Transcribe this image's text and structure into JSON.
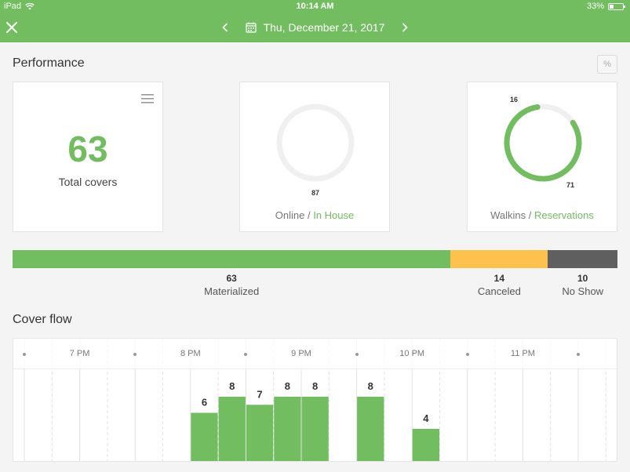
{
  "status_bar": {
    "device": "iPad",
    "time": "10:14 AM",
    "battery": "33%"
  },
  "header": {
    "date": "Thu, December 21, 2017"
  },
  "performance": {
    "title": "Performance",
    "percent_toggle": "%",
    "total": {
      "value": "63",
      "label": "Total covers"
    },
    "online_inhouse": {
      "value_bottom": "87",
      "label_a": "Online",
      "separator": " / ",
      "label_b": "In House",
      "online_fraction": 0
    },
    "walkins_reservations": {
      "value_top": "16",
      "value_bottom": "71",
      "label_a": "Walkins",
      "separator": " / ",
      "label_b": "Reservations",
      "reservations_fraction": 0.82
    }
  },
  "status_breakdown": [
    {
      "value": "63",
      "label": "Materialized",
      "color": "#72bd60"
    },
    {
      "value": "14",
      "label": "Canceled",
      "color": "#fdc24d"
    },
    {
      "value": "10",
      "label": "No Show",
      "color": "#5f5f5f"
    }
  ],
  "cover_flow": {
    "title": "Cover flow",
    "hours": [
      "7 PM",
      "8 PM",
      "9 PM",
      "10 PM",
      "11 PM"
    ],
    "bars": [
      0,
      0,
      0,
      0,
      0,
      0,
      6,
      8,
      7,
      8,
      8,
      0,
      8,
      0,
      4,
      0,
      0,
      0,
      0,
      0,
      0,
      0
    ],
    "max": 8
  },
  "colors": {
    "brand": "#72bd60",
    "canceled": "#fdc24d",
    "no_show": "#5f5f5f"
  }
}
